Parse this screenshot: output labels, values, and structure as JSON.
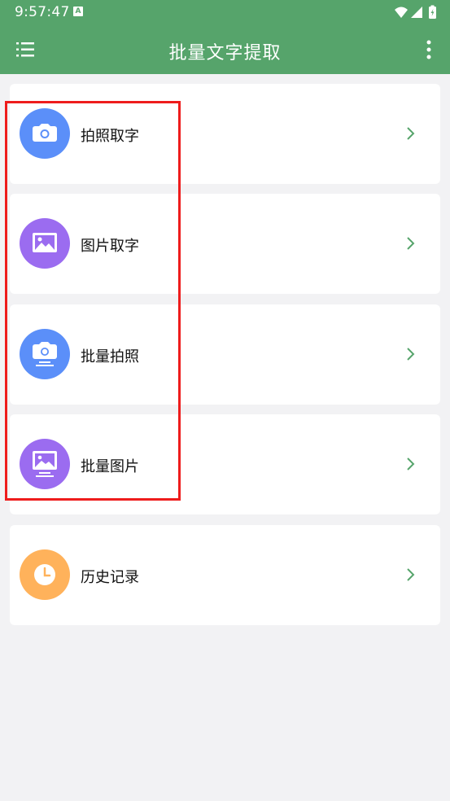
{
  "status_bar": {
    "time": "9:57:47",
    "notification_badge": "A"
  },
  "app_bar": {
    "title": "批量文字提取"
  },
  "colors": {
    "primary": "#56a46b",
    "icon_blue": "#5b8ff9",
    "icon_purple": "#9b6cf0",
    "icon_orange": "#ffb25b",
    "highlight_box": "#ee1c1c"
  },
  "menu_items": [
    {
      "label": "拍照取字",
      "icon": "camera-icon"
    },
    {
      "label": "图片取字",
      "icon": "image-icon"
    },
    {
      "label": "批量拍照",
      "icon": "camera-stack-icon"
    },
    {
      "label": "批量图片",
      "icon": "image-stack-icon"
    },
    {
      "label": "历史记录",
      "icon": "clock-icon"
    }
  ]
}
